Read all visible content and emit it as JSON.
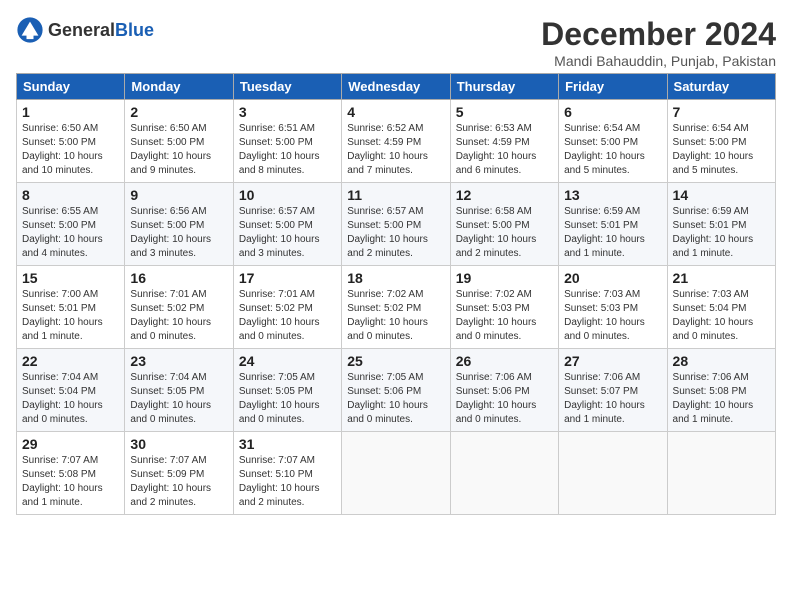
{
  "header": {
    "logo_general": "General",
    "logo_blue": "Blue",
    "month_year": "December 2024",
    "location": "Mandi Bahauddin, Punjab, Pakistan"
  },
  "weekdays": [
    "Sunday",
    "Monday",
    "Tuesday",
    "Wednesday",
    "Thursday",
    "Friday",
    "Saturday"
  ],
  "weeks": [
    [
      {
        "day": "1",
        "info": "Sunrise: 6:50 AM\nSunset: 5:00 PM\nDaylight: 10 hours and 10 minutes."
      },
      {
        "day": "2",
        "info": "Sunrise: 6:50 AM\nSunset: 5:00 PM\nDaylight: 10 hours and 9 minutes."
      },
      {
        "day": "3",
        "info": "Sunrise: 6:51 AM\nSunset: 5:00 PM\nDaylight: 10 hours and 8 minutes."
      },
      {
        "day": "4",
        "info": "Sunrise: 6:52 AM\nSunset: 4:59 PM\nDaylight: 10 hours and 7 minutes."
      },
      {
        "day": "5",
        "info": "Sunrise: 6:53 AM\nSunset: 4:59 PM\nDaylight: 10 hours and 6 minutes."
      },
      {
        "day": "6",
        "info": "Sunrise: 6:54 AM\nSunset: 5:00 PM\nDaylight: 10 hours and 5 minutes."
      },
      {
        "day": "7",
        "info": "Sunrise: 6:54 AM\nSunset: 5:00 PM\nDaylight: 10 hours and 5 minutes."
      }
    ],
    [
      {
        "day": "8",
        "info": "Sunrise: 6:55 AM\nSunset: 5:00 PM\nDaylight: 10 hours and 4 minutes."
      },
      {
        "day": "9",
        "info": "Sunrise: 6:56 AM\nSunset: 5:00 PM\nDaylight: 10 hours and 3 minutes."
      },
      {
        "day": "10",
        "info": "Sunrise: 6:57 AM\nSunset: 5:00 PM\nDaylight: 10 hours and 3 minutes."
      },
      {
        "day": "11",
        "info": "Sunrise: 6:57 AM\nSunset: 5:00 PM\nDaylight: 10 hours and 2 minutes."
      },
      {
        "day": "12",
        "info": "Sunrise: 6:58 AM\nSunset: 5:00 PM\nDaylight: 10 hours and 2 minutes."
      },
      {
        "day": "13",
        "info": "Sunrise: 6:59 AM\nSunset: 5:01 PM\nDaylight: 10 hours and 1 minute."
      },
      {
        "day": "14",
        "info": "Sunrise: 6:59 AM\nSunset: 5:01 PM\nDaylight: 10 hours and 1 minute."
      }
    ],
    [
      {
        "day": "15",
        "info": "Sunrise: 7:00 AM\nSunset: 5:01 PM\nDaylight: 10 hours and 1 minute."
      },
      {
        "day": "16",
        "info": "Sunrise: 7:01 AM\nSunset: 5:02 PM\nDaylight: 10 hours and 0 minutes."
      },
      {
        "day": "17",
        "info": "Sunrise: 7:01 AM\nSunset: 5:02 PM\nDaylight: 10 hours and 0 minutes."
      },
      {
        "day": "18",
        "info": "Sunrise: 7:02 AM\nSunset: 5:02 PM\nDaylight: 10 hours and 0 minutes."
      },
      {
        "day": "19",
        "info": "Sunrise: 7:02 AM\nSunset: 5:03 PM\nDaylight: 10 hours and 0 minutes."
      },
      {
        "day": "20",
        "info": "Sunrise: 7:03 AM\nSunset: 5:03 PM\nDaylight: 10 hours and 0 minutes."
      },
      {
        "day": "21",
        "info": "Sunrise: 7:03 AM\nSunset: 5:04 PM\nDaylight: 10 hours and 0 minutes."
      }
    ],
    [
      {
        "day": "22",
        "info": "Sunrise: 7:04 AM\nSunset: 5:04 PM\nDaylight: 10 hours and 0 minutes."
      },
      {
        "day": "23",
        "info": "Sunrise: 7:04 AM\nSunset: 5:05 PM\nDaylight: 10 hours and 0 minutes."
      },
      {
        "day": "24",
        "info": "Sunrise: 7:05 AM\nSunset: 5:05 PM\nDaylight: 10 hours and 0 minutes."
      },
      {
        "day": "25",
        "info": "Sunrise: 7:05 AM\nSunset: 5:06 PM\nDaylight: 10 hours and 0 minutes."
      },
      {
        "day": "26",
        "info": "Sunrise: 7:06 AM\nSunset: 5:06 PM\nDaylight: 10 hours and 0 minutes."
      },
      {
        "day": "27",
        "info": "Sunrise: 7:06 AM\nSunset: 5:07 PM\nDaylight: 10 hours and 1 minute."
      },
      {
        "day": "28",
        "info": "Sunrise: 7:06 AM\nSunset: 5:08 PM\nDaylight: 10 hours and 1 minute."
      }
    ],
    [
      {
        "day": "29",
        "info": "Sunrise: 7:07 AM\nSunset: 5:08 PM\nDaylight: 10 hours and 1 minute."
      },
      {
        "day": "30",
        "info": "Sunrise: 7:07 AM\nSunset: 5:09 PM\nDaylight: 10 hours and 2 minutes."
      },
      {
        "day": "31",
        "info": "Sunrise: 7:07 AM\nSunset: 5:10 PM\nDaylight: 10 hours and 2 minutes."
      },
      null,
      null,
      null,
      null
    ]
  ]
}
